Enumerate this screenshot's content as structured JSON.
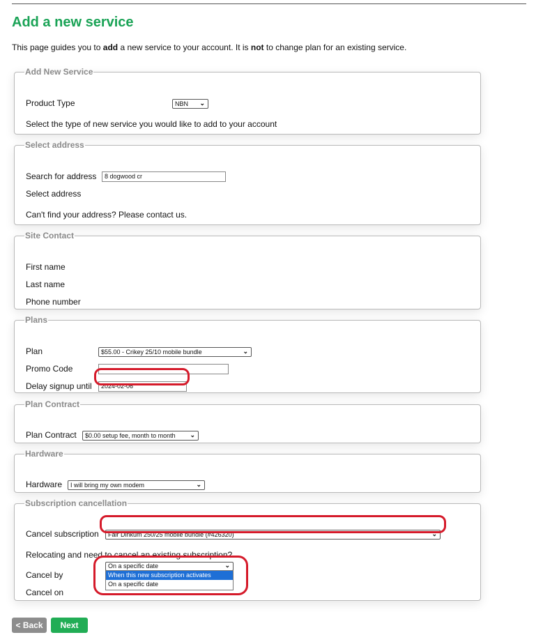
{
  "page": {
    "title": "Add a new service",
    "intro": {
      "pre": "This page guides you to ",
      "b1": "add",
      "mid": " a new service to your account. It is ",
      "b2": "not",
      "post": " to change plan for an existing service."
    }
  },
  "add_new_service": {
    "legend": "Add New Service",
    "product_type_label": "Product Type",
    "product_type_value": "NBN",
    "help": "Select the type of new service you would like to add to your account"
  },
  "select_address": {
    "legend": "Select address",
    "search_label": "Search for address",
    "search_value": "8 dogwood cr",
    "select_label": "Select address",
    "help": "Can't find your address? Please contact us."
  },
  "site_contact": {
    "legend": "Site Contact",
    "first_name_label": "First name",
    "last_name_label": "Last name",
    "phone_label": "Phone number"
  },
  "plans": {
    "legend": "Plans",
    "plan_label": "Plan",
    "plan_value": "$55.00 - Crikey 25/10 mobile bundle",
    "promo_label": "Promo Code",
    "promo_value": "",
    "delay_label": "Delay signup until",
    "delay_value": "2024-02-06"
  },
  "plan_contract": {
    "legend": "Plan Contract",
    "label": "Plan Contract",
    "value": "$0.00 setup fee, month to month"
  },
  "hardware": {
    "legend": "Hardware",
    "label": "Hardware",
    "value": "I will bring my own modem"
  },
  "subscription_cancellation": {
    "legend": "Subscription cancellation",
    "cancel_sub_label": "Cancel subscription",
    "cancel_sub_value": "Fair Dinkum 250/25 mobile bundle (#426320)",
    "relocating_text": "Relocating and need to cancel an existing subscription?",
    "cancel_by_label": "Cancel by",
    "cancel_by_value": "On a specific date",
    "cancel_by_options": [
      "When this new subscription activates",
      "On a specific date"
    ],
    "cancel_on_label": "Cancel on"
  },
  "buttons": {
    "back": "< Back",
    "next": "Next"
  },
  "colors": {
    "title_green": "#1aa356",
    "next_green": "#21ad55",
    "highlight_red": "#d51a2a",
    "option_blue": "#1e6fd6"
  },
  "icons": {
    "select_chevron": "chevron-down-icon"
  }
}
